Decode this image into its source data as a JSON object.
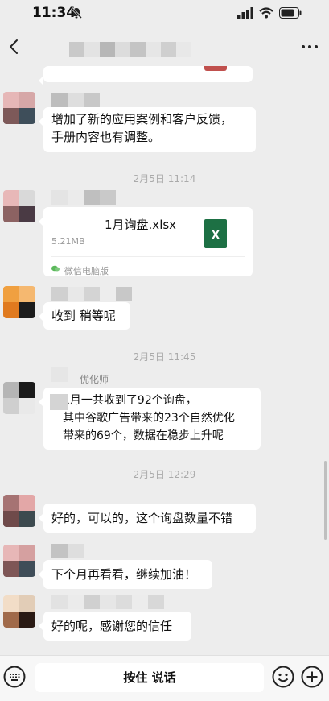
{
  "status_bar": {
    "time": "11:34"
  },
  "messages": [
    {
      "text": "增加了新的应用案例和客户反馈，\n手册内容也有调整。"
    },
    {
      "timestamp": "2月5日 11:14"
    },
    {
      "file_name": "1月询盘.xlsx",
      "file_size": "5.21MB",
      "source": "微信电脑版",
      "file_icon_letter": "X"
    },
    {
      "text": "收到 稍等呢"
    },
    {
      "timestamp": "2月5日 11:45"
    },
    {
      "name_fragment": "优化师",
      "text": "，1月一共收到了92个询盘，\n其中谷歌广告带来的23个自然优化\n带来的69个，数据在稳步上升呢"
    },
    {
      "timestamp": "2月5日 12:29"
    },
    {
      "text": "好的，可以的，这个询盘数量不错"
    },
    {
      "text": "下个月再看看，继续加油！"
    },
    {
      "text": "好的呢，感谢您的信任"
    }
  ],
  "input_bar": {
    "voice_label": "按住 说话"
  },
  "colors": {
    "background": "#ededed",
    "bubble": "#ffffff",
    "excel_green": "#1d7044",
    "timestamp": "#aaaaaa"
  }
}
